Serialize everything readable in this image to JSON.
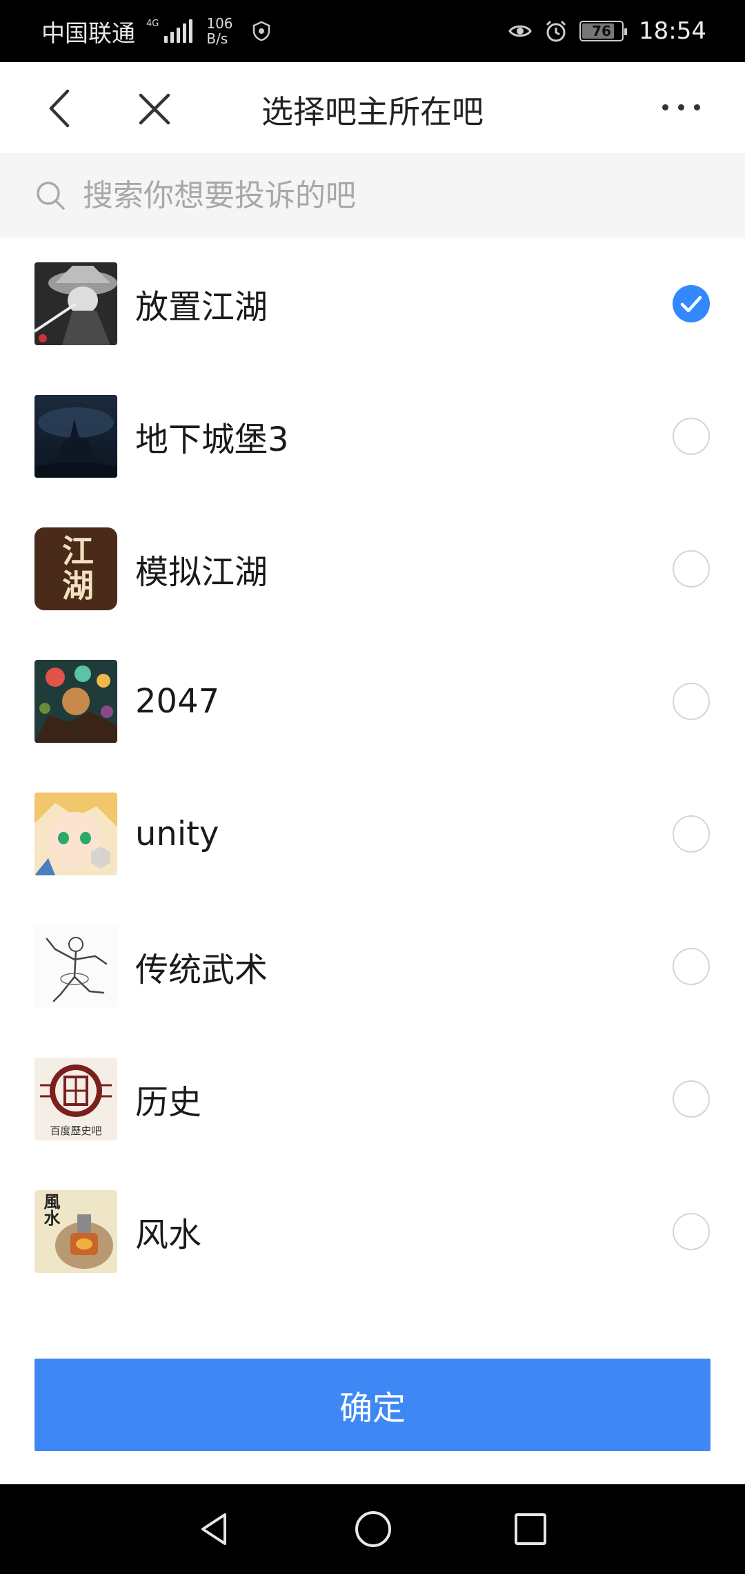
{
  "status_bar": {
    "carrier": "中国联通",
    "network_type": "4G",
    "speed_value": "106",
    "speed_unit": "B/s",
    "battery": "76",
    "time": "18:54"
  },
  "nav": {
    "title": "选择吧主所在吧",
    "back_icon": "chevron-left-icon",
    "close_icon": "close-icon",
    "more_icon": "more-horizontal-icon"
  },
  "search": {
    "placeholder": "搜索你想要投诉的吧",
    "value": ""
  },
  "list": {
    "items": [
      {
        "name": "放置江湖",
        "selected": true,
        "icon": "swordsman-thumbnail"
      },
      {
        "name": "地下城堡3",
        "selected": false,
        "icon": "castle-night-thumbnail"
      },
      {
        "name": "模拟江湖",
        "selected": false,
        "icon": "jianghu-calligraphy-thumbnail",
        "icon_text": "江湖"
      },
      {
        "name": "2047",
        "selected": false,
        "icon": "colorful-game-art-thumbnail"
      },
      {
        "name": "unity",
        "selected": false,
        "icon": "anime-character-thumbnail"
      },
      {
        "name": "传统武术",
        "selected": false,
        "icon": "martial-arts-sketch-thumbnail"
      },
      {
        "name": "历史",
        "selected": false,
        "icon": "history-seal-thumbnail",
        "icon_text": "百度歷史吧"
      },
      {
        "name": "风水",
        "selected": false,
        "icon": "fengshui-thumbnail",
        "icon_text": "風水"
      }
    ]
  },
  "confirm_label": "确定",
  "colors": {
    "accent": "#3388ff",
    "button": "#3d88f5",
    "search_bg": "#f5f5f5",
    "statusbar_bg": "#000000"
  }
}
